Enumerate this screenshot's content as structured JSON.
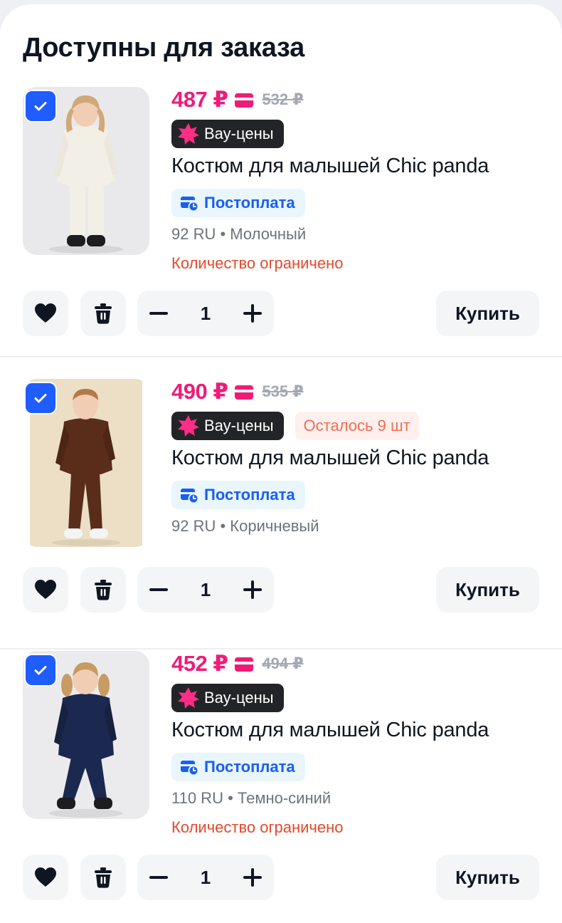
{
  "section": {
    "title": "Доступны для заказа"
  },
  "products": [
    {
      "price": "487 ₽",
      "old_price": "532 ₽",
      "badge": "Вау-цены",
      "title": "Костюм для малышей Chic panda",
      "payment": "Постоплата",
      "variant": "92 RU • Молочный",
      "limited": "Количество ограничено",
      "quantity": "1",
      "buy_label": "Купить",
      "image_colors": {
        "bg": "#e9e9eb",
        "outfit": "#f2efe6",
        "hair": "#d1a877",
        "skin": "#f1cdb4",
        "shoes": "#1d1d1f"
      }
    },
    {
      "price": "490 ₽",
      "old_price": "535 ₽",
      "badge": "Вау-цены",
      "stock": "Осталось 9 шт",
      "title": "Костюм для малышей Chic panda",
      "payment": "Постоплата",
      "variant": "92 RU • Коричневый",
      "quantity": "1",
      "buy_label": "Купить",
      "image_colors": {
        "bg": "#ecdfc6",
        "outfit": "#5a2d1a",
        "hair": "#b2794a",
        "skin": "#f1cdb4",
        "shoes": "#f4f4f4"
      }
    },
    {
      "price": "452 ₽",
      "old_price": "494 ₽",
      "badge": "Вау-цены",
      "title": "Костюм для малышей Chic panda",
      "payment": "Постоплата",
      "variant": "110 RU • Темно-синий",
      "limited": "Количество ограничено",
      "quantity": "1",
      "buy_label": "Купить",
      "image_colors": {
        "bg": "#ebebed",
        "outfit": "#1b2850",
        "hair": "#c79b62",
        "skin": "#f1cdb4",
        "shoes": "#1d1d1f"
      }
    }
  ],
  "colors": {
    "price": "#f01b78",
    "checkbox": "#1f5dff",
    "limited_text": "#e24a2c",
    "postpay_text": "#1a5df5",
    "postpay_bg": "#e9f6fd",
    "stock_text": "#f26c54",
    "stock_bg": "#fff0ee",
    "badge_bg": "#222427"
  },
  "icons": {
    "checkbox": "check-icon",
    "price_card": "card-icon",
    "badge": "pink-splash-icon",
    "payment": "wallet-clock-icon",
    "favorite": "heart-icon",
    "delete": "trash-icon",
    "decrease": "minus-icon",
    "increase": "plus-icon"
  }
}
